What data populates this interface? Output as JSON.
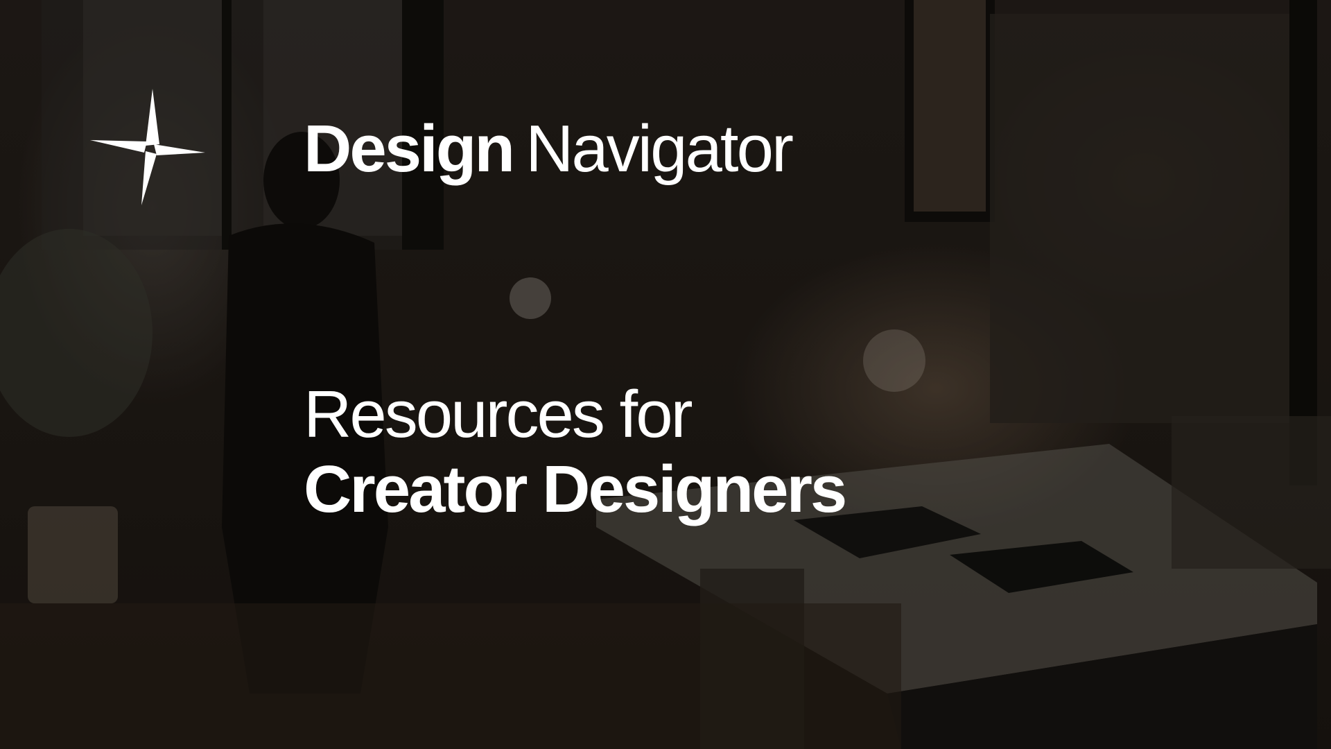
{
  "brand": {
    "name_bold": "Design",
    "name_light": "Navigator",
    "logo_icon": "four-point-star-icon"
  },
  "hero": {
    "line1": "Resources for",
    "line2": "Creator Designers"
  },
  "colors": {
    "text": "#ffffff",
    "background": "#1f1915"
  }
}
